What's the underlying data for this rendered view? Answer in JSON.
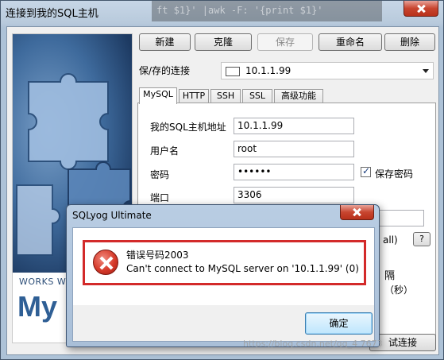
{
  "main_window": {
    "title": "连接到我的SQL主机",
    "background_terminal_text": "ft $1}' |awk -F: '{print $1}'"
  },
  "side_panel": {
    "works_text": "WORKS WI",
    "logo_text": "My"
  },
  "toolbar": {
    "new_label": "新建",
    "clone_label": "克隆",
    "save_label": "保存",
    "rename_label": "重命名",
    "delete_label": "删除"
  },
  "saved_connection": {
    "label": "保/存的连接",
    "value": "10.1.1.99"
  },
  "tabs": [
    {
      "label": "MySQL",
      "active": true
    },
    {
      "label": "HTTP",
      "active": false
    },
    {
      "label": "SSH",
      "active": false
    },
    {
      "label": "SSL",
      "active": false
    },
    {
      "label": "高级功能",
      "active": false
    }
  ],
  "mysql_form": {
    "host_label": "我的SQL主机地址",
    "host_value": "10.1.1.99",
    "user_label": "用户名",
    "user_value": "root",
    "password_label": "密码",
    "password_value": "••••••",
    "save_password_label": "保存密码",
    "save_password_checked": true,
    "port_label": "端口",
    "port_value": "3306",
    "hidden_label_partial": "all)",
    "help_label": "?",
    "interval_partial": "隔",
    "seconds_partial": "（秒）",
    "connect_partial": "试连接"
  },
  "error_dialog": {
    "title": "SQLyog Ultimate",
    "error_code": "错误号码2003",
    "error_message": "Can't connect to MySQL server on '10.1.1.99' (0)",
    "ok_label": "确定"
  },
  "watermark": "https://blog.csdn.net/qq_4        7673",
  "colors": {
    "error_highlight": "#d32a2a",
    "ok_button_border": "#3c7fb1"
  }
}
